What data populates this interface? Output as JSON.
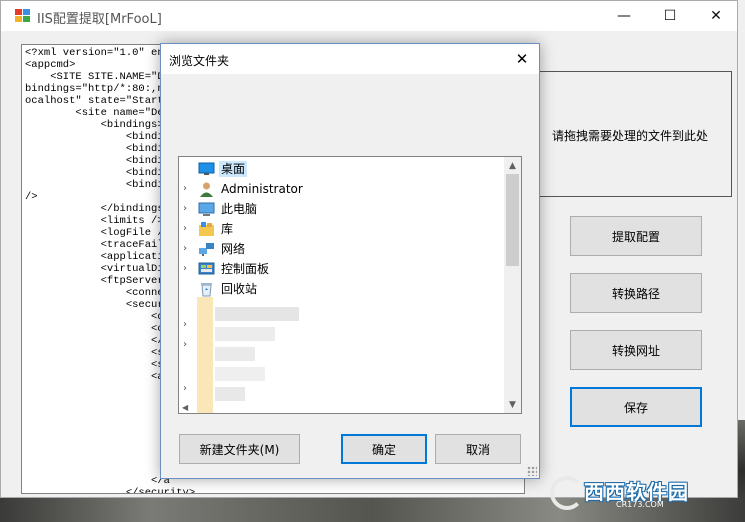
{
  "main_window": {
    "title": "IIS配置提取[MrFooL]",
    "minimize_glyph": "—",
    "maximize_glyph": "☐",
    "close_glyph": "✕"
  },
  "xml_editor": {
    "lines": [
      "<?xml version=\"1.0\" enc",
      "<appcmd>",
      "    <SITE SITE.NAME=\"De",
      "bindings=\"http/*:80:,ne",
      "ocalhost\" state=\"Starte",
      "        <site name=\"Def",
      "            <bindings>",
      "                <bindin",
      "                <bindin",
      "                <bindin",
      "                <bindin",
      "                <bindin",
      "/>",
      "            </bindings>",
      "            <limits />",
      "            <logFile />",
      "            <traceFaile",
      "            <applicatio",
      "            <virtualDir",
      "            <ftpServer>",
      "                <connec",
      "                <securi",
      "                    <da",
      "                    <co",
      "                    </c",
      "                    <ss",
      "                    <ss",
      "                    <au"
    ],
    "bottom_lines": [
      "                    </a",
      "                </security>"
    ]
  },
  "drop_zone": {
    "text": "请拖拽需要处理的文件到此处"
  },
  "actions": {
    "extract": "提取配置",
    "convert_path": "转换路径",
    "convert_url": "转换网址",
    "save": "保存"
  },
  "dialog": {
    "title": "浏览文件夹",
    "close_glyph": "✕",
    "tree": [
      {
        "label": "桌面",
        "icon": "desktop-icon",
        "selected": true,
        "expandable": false
      },
      {
        "label": "Administrator",
        "icon": "user-icon",
        "selected": false,
        "expandable": true
      },
      {
        "label": "此电脑",
        "icon": "computer-icon",
        "selected": false,
        "expandable": true
      },
      {
        "label": "库",
        "icon": "library-icon",
        "selected": false,
        "expandable": true
      },
      {
        "label": "网络",
        "icon": "network-icon",
        "selected": false,
        "expandable": true
      },
      {
        "label": "控制面板",
        "icon": "control-panel-icon",
        "selected": false,
        "expandable": true
      },
      {
        "label": "回收站",
        "icon": "recycle-bin-icon",
        "selected": false,
        "expandable": false
      }
    ],
    "buttons": {
      "new_folder": "新建文件夹(M)",
      "ok": "确定",
      "cancel": "取消"
    }
  },
  "watermark": {
    "text": "西西软件园",
    "sub": "CR173.COM"
  },
  "colors": {
    "accent": "#0078d7",
    "selection": "#cce8ff"
  }
}
